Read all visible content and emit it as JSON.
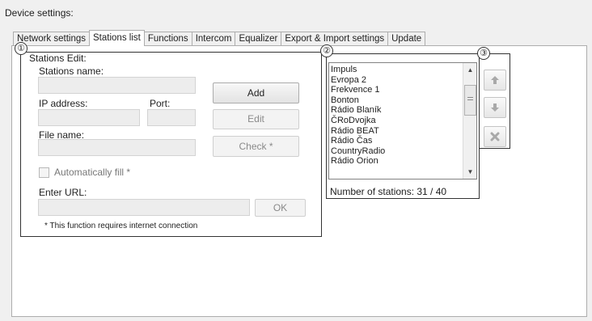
{
  "title": "Device settings:",
  "tabs": [
    {
      "label": "Network settings"
    },
    {
      "label": "Stations list"
    },
    {
      "label": "Functions"
    },
    {
      "label": "Intercom"
    },
    {
      "label": "Equalizer"
    },
    {
      "label": "Export & Import settings"
    },
    {
      "label": "Update"
    }
  ],
  "active_tab": "Stations list",
  "markers": [
    "①",
    "②",
    "③"
  ],
  "edit": {
    "group_label": "Stations Edit:",
    "station_name_label": "Stations name:",
    "ip_label": "IP address:",
    "port_label": "Port:",
    "file_label": "File name:",
    "add": "Add",
    "edit": "Edit",
    "check": "Check *",
    "auto_fill": "Automatically fill *",
    "url_label": "Enter URL:",
    "ok": "OK",
    "note": "* This function requires internet connection"
  },
  "stations": [
    "Impuls",
    "Evropa 2",
    "Frekvence 1",
    "Bonton",
    "Rádio Blaník",
    "ČRoDvojka",
    "Rádio BEAT",
    "Rádio Čas",
    "CountryRadio",
    "Rádio Orion"
  ],
  "station_count": "Number of stations: 31 / 40",
  "side_buttons": {
    "up": "arrow-up-icon",
    "down": "arrow-down-icon",
    "delete": "delete-x-icon"
  }
}
